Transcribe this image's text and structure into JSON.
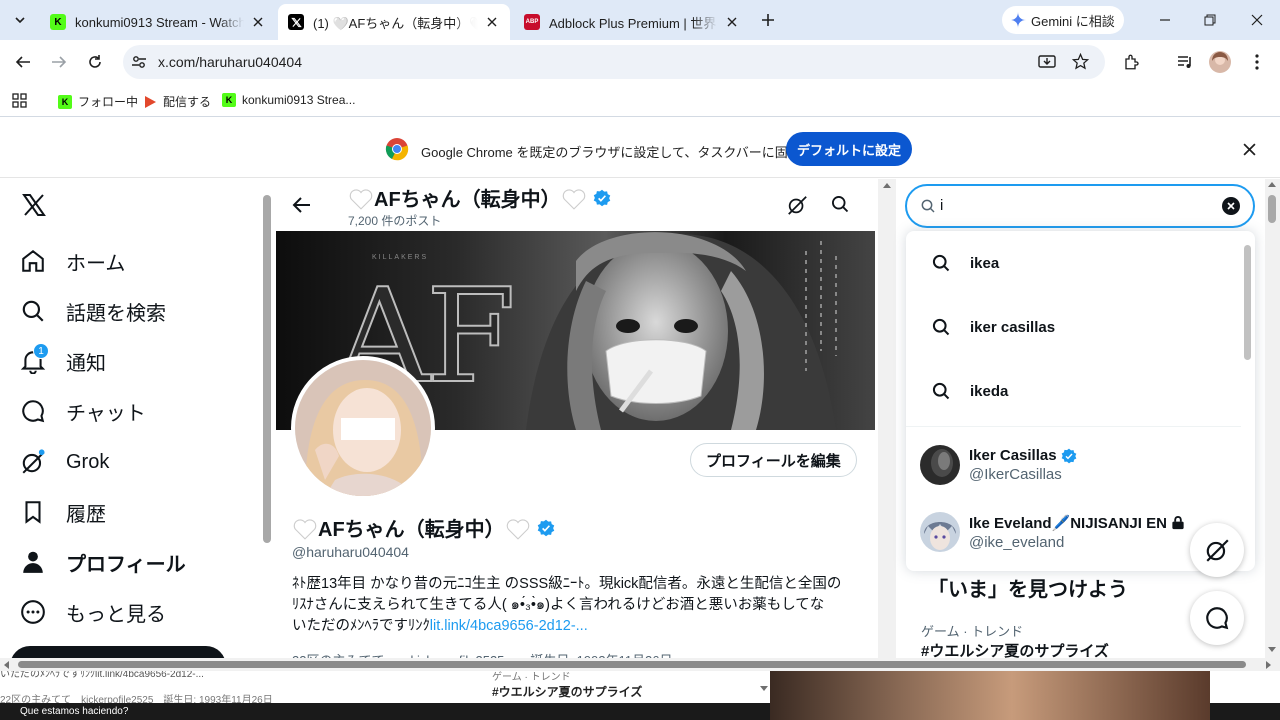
{
  "tabs": [
    {
      "title": "konkumi0913 Stream - Watch L",
      "favicon": "kick-icon",
      "active": false
    },
    {
      "title": "(1) 🤍AFちゃん（転身中）🤍 (",
      "favicon": "x-icon",
      "active": true
    },
    {
      "title": "Adblock Plus Premium | 世界 N",
      "favicon": "abp-icon",
      "active": false
    }
  ],
  "abp_badge": "ABP",
  "gemini_label": "Gemini に相談",
  "url": "x.com/haruharu040404",
  "bookmarks": [
    {
      "label": "フォロー中",
      "favicon": "kick-icon"
    },
    {
      "label": "配信する",
      "favicon": "play-icon"
    },
    {
      "label": "konkumi0913 Strea...",
      "favicon": "kick-icon"
    }
  ],
  "infobar": {
    "message": "Google Chrome を既定のブラウザに設定して、タスクバーに固定する",
    "button": "デフォルトに設定"
  },
  "nav": {
    "items": [
      {
        "label": "ホーム",
        "icon": "home-icon"
      },
      {
        "label": "話題を検索",
        "icon": "search-icon"
      },
      {
        "label": "通知",
        "icon": "bell-icon",
        "badge": "1"
      },
      {
        "label": "チャット",
        "icon": "chat-icon"
      },
      {
        "label": "Grok",
        "icon": "grok-icon"
      },
      {
        "label": "履歴",
        "icon": "bookmark-icon"
      },
      {
        "label": "プロフィール",
        "icon": "person-icon"
      },
      {
        "label": "もっと見る",
        "icon": "more-icon"
      }
    ]
  },
  "header": {
    "name": "AFちゃん（転身中）",
    "post_count": "7,200 件のポスト"
  },
  "banner": {
    "logo_text": "AF",
    "caption": "KILLAKERS"
  },
  "profile": {
    "edit_button": "プロフィールを編集",
    "name": "AFちゃん（転身中）",
    "handle": "@haruharu040404",
    "bio_line1": "ﾈﾄ歴13年目 かなり昔の元ﾆｺ生主 のSSS級ﾆｰﾄ。現kick配信者。永遠と生配信と全国の",
    "bio_line2": "ﾘｽﾅさんに支えられて生きてる人( ๑•́₃•̀๑)よく言われるけどお酒と悪いお薬もしてな",
    "bio_line3": "いただのﾒﾝﾍﾗですﾘﾝｸ",
    "bio_link": "lit.link/4bca9656-2d12-...",
    "meta_partial": "22区の主みてて　　kickerpofile2525　　誕生日: 1993年11月26日"
  },
  "search": {
    "query": "i",
    "suggestions": [
      "ikea",
      "iker casillas",
      "ikeda"
    ],
    "users": [
      {
        "name": "Iker Casillas",
        "handle": "@IkerCasillas",
        "verified": true
      },
      {
        "name": "Ike Eveland🖊️NIJISANJI EN",
        "handle": "@ike_eveland",
        "verified": false,
        "locked": true
      }
    ]
  },
  "right": {
    "section_title": "「いま」を見つけよう",
    "trend_meta": "ゲーム · トレンド",
    "trend_name": "#ウエルシア夏のサプライズ"
  },
  "bottom_strip": {
    "bio_partial": "いただのﾒﾝﾍﾗですﾘﾝｸlit.link/4bca9656-2d12-...",
    "meta_partial": "22区の主みてて　kickerpofile2525　誕生日: 1993年11月26日",
    "trend_meta": "ゲーム · トレンド",
    "trend_name": "#ウエルシア夏のサプライズ",
    "chat_partial": "Que estamos haciendo?"
  },
  "colors": {
    "x_blue": "#1d9bf0",
    "chrome_blue": "#0b57d0",
    "kick_green": "#53fc18"
  }
}
